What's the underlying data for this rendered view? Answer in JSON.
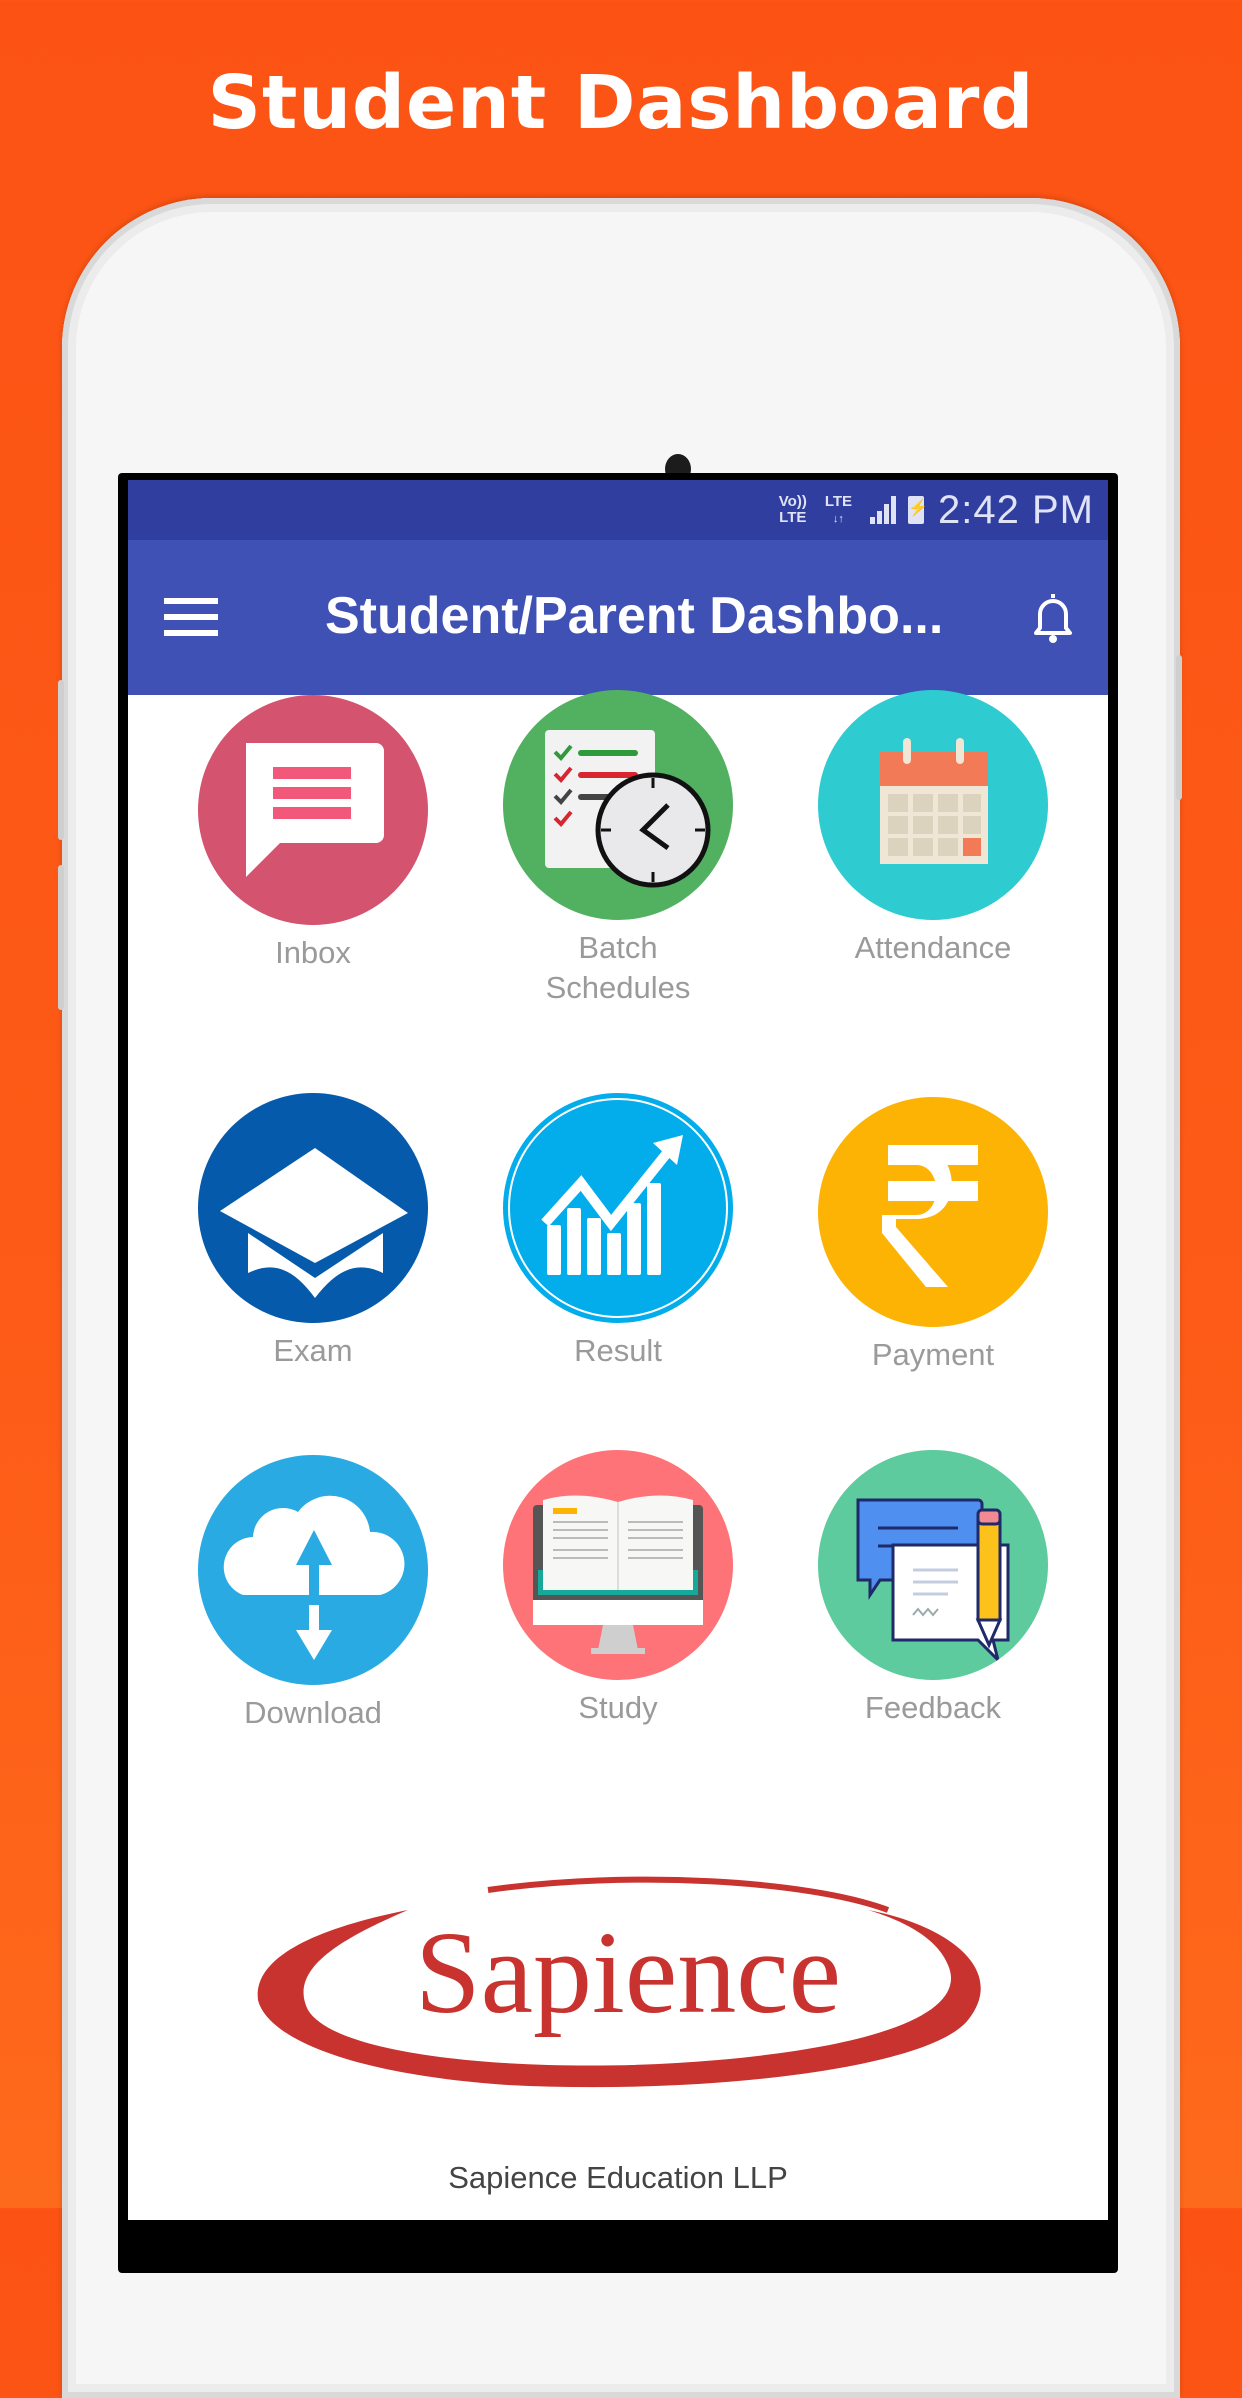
{
  "promo": {
    "title": "Student Dashboard"
  },
  "status_bar": {
    "volte": "Vo)) LTE",
    "network": "LTE",
    "time": "2:42 PM"
  },
  "app_bar": {
    "menu_icon": "hamburger-menu-icon",
    "title": "Student/Parent Dashbo...",
    "notification_icon": "bell-icon"
  },
  "dashboard": {
    "tiles": [
      {
        "label": "Inbox",
        "icon": "chat-bubble-icon",
        "color": "#d4536e"
      },
      {
        "label": "Batch\nSchedules",
        "label_line1": "Batch",
        "label_line2": "Schedules",
        "icon": "checklist-clock-icon",
        "color": "#52b061"
      },
      {
        "label": "Attendance",
        "icon": "calendar-icon",
        "color": "#2ecbd0"
      },
      {
        "label": "Exam",
        "icon": "graduation-cap-icon",
        "color": "#055aab"
      },
      {
        "label": "Result",
        "icon": "growth-chart-icon",
        "color": "#03adec"
      },
      {
        "label": "Payment",
        "icon": "rupee-icon",
        "color": "#fdb303"
      },
      {
        "label": "Download",
        "icon": "cloud-transfer-icon",
        "color": "#2aaae2"
      },
      {
        "label": "Study",
        "icon": "book-monitor-icon",
        "color": "#fd7377"
      },
      {
        "label": "Feedback",
        "icon": "feedback-pencil-icon",
        "color": "#5dcb9e"
      }
    ]
  },
  "footer": {
    "logo_text": "Sapience",
    "company": "Sapience Education LLP",
    "brand_color": "#c8322f"
  },
  "colors": {
    "background": "#fc5314",
    "status_bar": "#303f9f",
    "app_bar": "#3f51b5",
    "label": "#9a9a9a"
  }
}
